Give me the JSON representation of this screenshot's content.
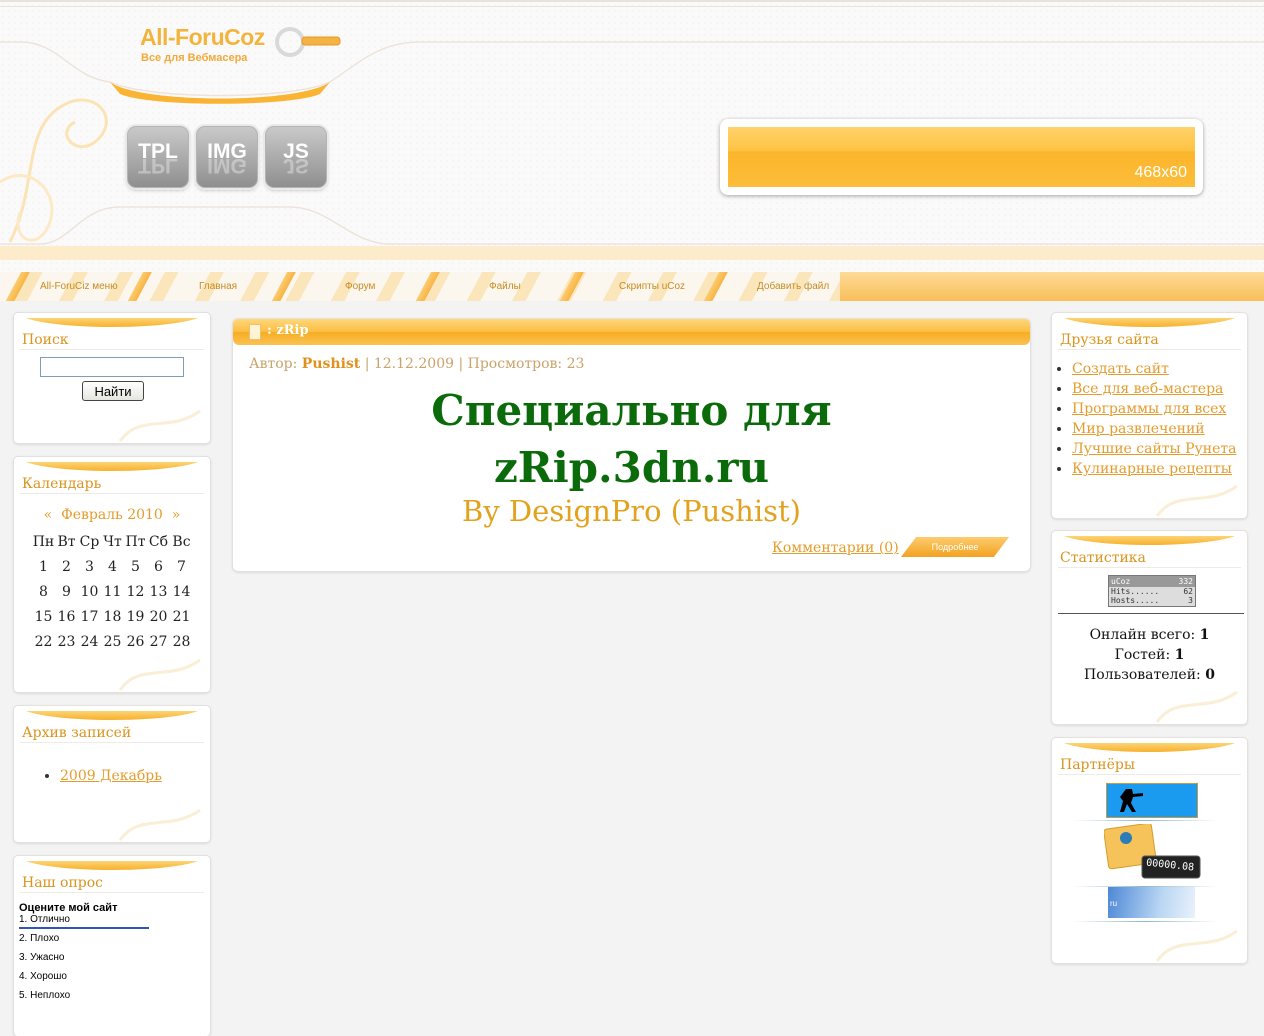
{
  "header": {
    "logo_title": "All-ForuCoz",
    "logo_subtitle": "Все для Вебмасера",
    "buttons": [
      {
        "label": "TPL"
      },
      {
        "label": "IMG"
      },
      {
        "label": "JS"
      }
    ],
    "banner_label": "468x60"
  },
  "nav": {
    "items": [
      {
        "label": "All-ForuCiz меню"
      },
      {
        "label": "Главная"
      },
      {
        "label": "Форум"
      },
      {
        "label": "Файлы"
      },
      {
        "label": "Скрипты uCoz"
      },
      {
        "label": "Добавить файл"
      }
    ]
  },
  "search": {
    "title": "Поиск",
    "input_value": "",
    "button_label": "Найти"
  },
  "calendar": {
    "title": "Календарь",
    "prev": "«",
    "month": "Февраль 2010",
    "next": "»",
    "weekdays": [
      "Пн",
      "Вт",
      "Ср",
      "Чт",
      "Пт",
      "Сб",
      "Вс"
    ],
    "weeks": [
      [
        "1",
        "2",
        "3",
        "4",
        "5",
        "6",
        "7"
      ],
      [
        "8",
        "9",
        "10",
        "11",
        "12",
        "13",
        "14"
      ],
      [
        "15",
        "16",
        "17",
        "18",
        "19",
        "20",
        "21"
      ],
      [
        "22",
        "23",
        "24",
        "25",
        "26",
        "27",
        "28"
      ]
    ]
  },
  "archive": {
    "title": "Архив записей",
    "items": [
      "2009 Декабрь"
    ]
  },
  "poll": {
    "title": "Наш опрос",
    "question": "Оцените мой сайт",
    "options": [
      "1. Отлично",
      "2. Плохо",
      "3. Ужасно",
      "4. Хорошо",
      "5. Неплохо"
    ]
  },
  "friends": {
    "title": "Друзья сайта",
    "links": [
      "Создать сайт",
      "Все для веб-мастера",
      "Программы для всех",
      "Мир развлечений",
      "Лучшие сайты Рунета",
      "Кулинарные рецепты"
    ]
  },
  "stats": {
    "title": "Статистика",
    "counter": {
      "brand": "uCoz",
      "total": "332",
      "hits_label": "Hits......",
      "hits": "62",
      "hosts_label": "Hosts.....",
      "hosts": "3"
    },
    "online_label": "Онлайн всего:",
    "online_value": "1",
    "guests_label": "Гостей:",
    "guests_value": "1",
    "users_label": "Пользователей:",
    "users_value": "0"
  },
  "partners": {
    "title": "Партнёры",
    "odometer": "00000.08",
    "banner_text": "ru"
  },
  "post": {
    "title": ": zRip",
    "author_label": "Автор:",
    "author": "Pushist",
    "date": "| 12.12.2009 |",
    "views_label": "Просмотров:",
    "views": "23",
    "headline_1": "Специально для",
    "headline_2": "zRip.3dn.ru",
    "byline": "By DesignPro (Pushist)",
    "comments": "Комментарии (0)",
    "more": "Подробнее"
  },
  "colors": {
    "accent": "#f8b12c",
    "link": "#e49c2c",
    "headline": "#0b6b0b"
  }
}
